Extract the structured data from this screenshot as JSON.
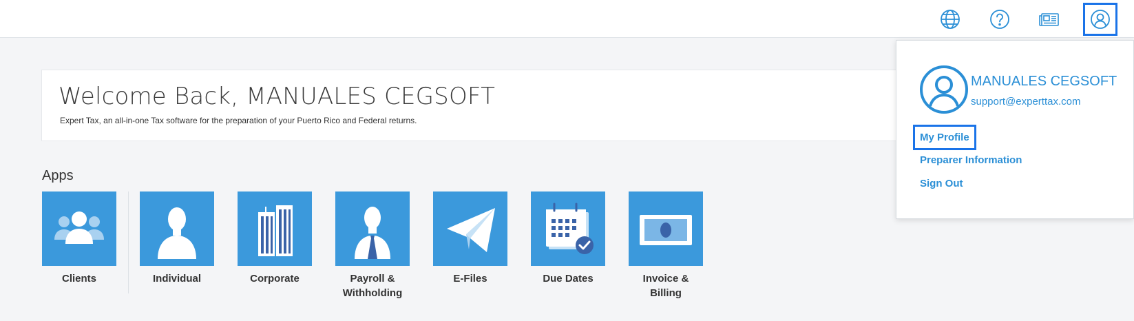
{
  "header": {
    "icons": [
      {
        "name": "globe-icon"
      },
      {
        "name": "help-icon"
      },
      {
        "name": "news-icon"
      },
      {
        "name": "user-account-icon"
      }
    ]
  },
  "welcome": {
    "title": "Welcome Back, MANUALES CEGSOFT",
    "subtitle": "Expert Tax, an all-in-one Tax software for the preparation of your Puerto Rico and Federal returns."
  },
  "apps": {
    "heading": "Apps",
    "items": [
      {
        "label": "Clients",
        "icon": "clients-icon"
      },
      {
        "label": "Individual",
        "icon": "individual-icon"
      },
      {
        "label": "Corporate",
        "icon": "corporate-icon"
      },
      {
        "label": "Payroll & Withholding",
        "icon": "payroll-icon"
      },
      {
        "label": "E-Files",
        "icon": "efiles-icon"
      },
      {
        "label": "Due Dates",
        "icon": "due-dates-icon"
      },
      {
        "label": "Invoice & Billing",
        "icon": "invoice-billing-icon"
      }
    ]
  },
  "user_menu": {
    "name": "MANUALES CEGSOFT",
    "email": "support@experttax.com",
    "links": [
      "My Profile",
      "Preparer Information",
      "Sign Out"
    ]
  },
  "colors": {
    "accent": "#3b99dc",
    "link": "#2b8fd6",
    "focus_outline": "#1a73e8"
  }
}
